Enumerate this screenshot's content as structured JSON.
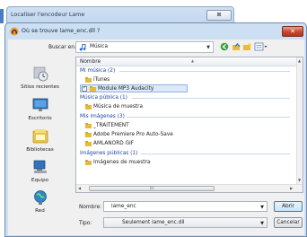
{
  "outer_window": {
    "title": "Localiser l'encodeur Lame"
  },
  "dialog": {
    "title": "Où se trouve lame_enc.dll ?",
    "close_glyph": "✕"
  },
  "lookin": {
    "label": "Buscar en:",
    "value": "Música"
  },
  "places": [
    "Sitios recientes",
    "Escritorio",
    "Bibliotecas",
    "Equipo",
    "Red"
  ],
  "list": {
    "column_name": "Nombre",
    "groups": [
      {
        "title": "Mi música (2)",
        "items": [
          "iTunes",
          "Module MP3 Audacity"
        ]
      },
      {
        "title": "Música pública (1)",
        "items": [
          "Música de muestra"
        ]
      },
      {
        "title": "Mis imágenes (3)",
        "items": [
          "_TRAITEMENT",
          "Adobe Premiere Pro Auto-Save",
          "AMLANORD GIF"
        ]
      },
      {
        "title": "Imágenes públicas (1)",
        "items": [
          "Imágenes de muestra"
        ]
      }
    ],
    "scroll_thumb_glyph": "III"
  },
  "filename": {
    "label": "Nombre:",
    "value": "lame_enc"
  },
  "filetype": {
    "label": "Tipo:",
    "value": "Seulement lame_enc.dll"
  },
  "buttons": {
    "open": "Abrir",
    "cancel": "Cancelar"
  },
  "colors": {
    "selection": "#dde9f8",
    "group_heading": "#1f47a3",
    "close_button": "#c9452d"
  }
}
